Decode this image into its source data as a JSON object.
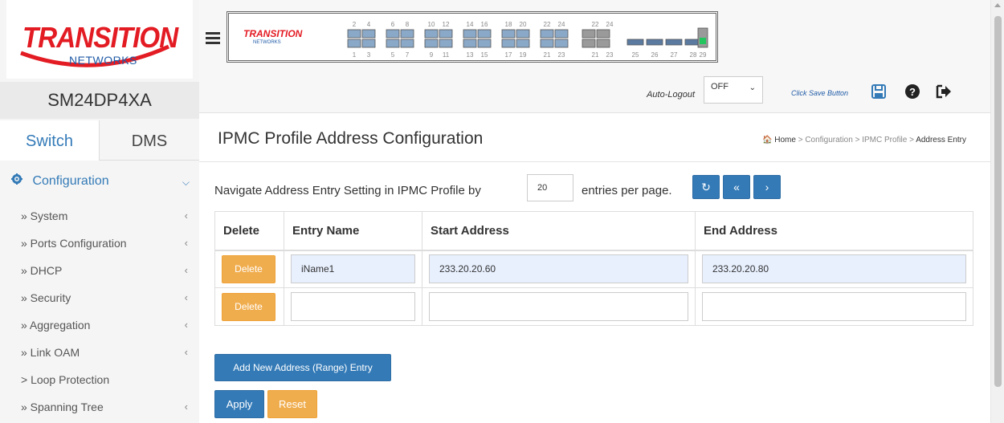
{
  "brand": {
    "logo_main": "TRANSITION",
    "logo_sub": "NETWORKS",
    "model": "SM24DP4XA"
  },
  "sidebar": {
    "tabs": [
      {
        "label": "Switch"
      },
      {
        "label": "DMS"
      }
    ],
    "section": {
      "label": "Configuration",
      "icon": "gear-icon"
    },
    "items": [
      {
        "label": "» System"
      },
      {
        "label": "» Ports Configuration"
      },
      {
        "label": "» DHCP"
      },
      {
        "label": "» Security"
      },
      {
        "label": "» Aggregation"
      },
      {
        "label": "» Link OAM"
      },
      {
        "label": "> Loop Protection"
      },
      {
        "label": "» Spanning Tree"
      }
    ]
  },
  "topbar": {
    "panel_logo_main": "TRANSITION",
    "panel_logo_sub": "NETWORKS",
    "ports_top": [
      "2",
      "4",
      "6",
      "8",
      "10",
      "12",
      "14",
      "16",
      "18",
      "20",
      "22",
      "24",
      "22",
      "24"
    ],
    "ports_bottom": [
      "1",
      "3",
      "5",
      "7",
      "9",
      "11",
      "13",
      "15",
      "17",
      "19",
      "21",
      "23",
      "21",
      "23",
      "25",
      "26",
      "27",
      "28",
      "29"
    ],
    "auto_logout_label": "Auto-Logout",
    "auto_logout_value": "OFF",
    "save_label": "Click Save Button"
  },
  "page": {
    "title": "IPMC Profile Address Configuration",
    "breadcrumb": {
      "home": "Home",
      "sep": ">",
      "items": [
        "Configuration",
        "IPMC Profile",
        "Address Entry"
      ]
    },
    "navigate_prefix": "Navigate Address Entry Setting in IPMC Profile by",
    "entries_value": "20",
    "navigate_suffix": "entries per page."
  },
  "table": {
    "headers": [
      "Delete",
      "Entry Name",
      "Start Address",
      "End Address"
    ],
    "rows": [
      {
        "delete_label": "Delete",
        "entry_name": "iName1",
        "start": "233.20.20.60",
        "end": "233.20.20.80"
      },
      {
        "delete_label": "Delete",
        "entry_name": "",
        "start": "",
        "end": ""
      }
    ]
  },
  "actions": {
    "add_label": "Add New Address (Range) Entry",
    "apply_label": "Apply",
    "reset_label": "Reset"
  },
  "colors": {
    "primary": "#337ab7",
    "warning": "#f0ad4e",
    "brand_red": "#e31b23",
    "brand_blue": "#1f5aa6"
  }
}
